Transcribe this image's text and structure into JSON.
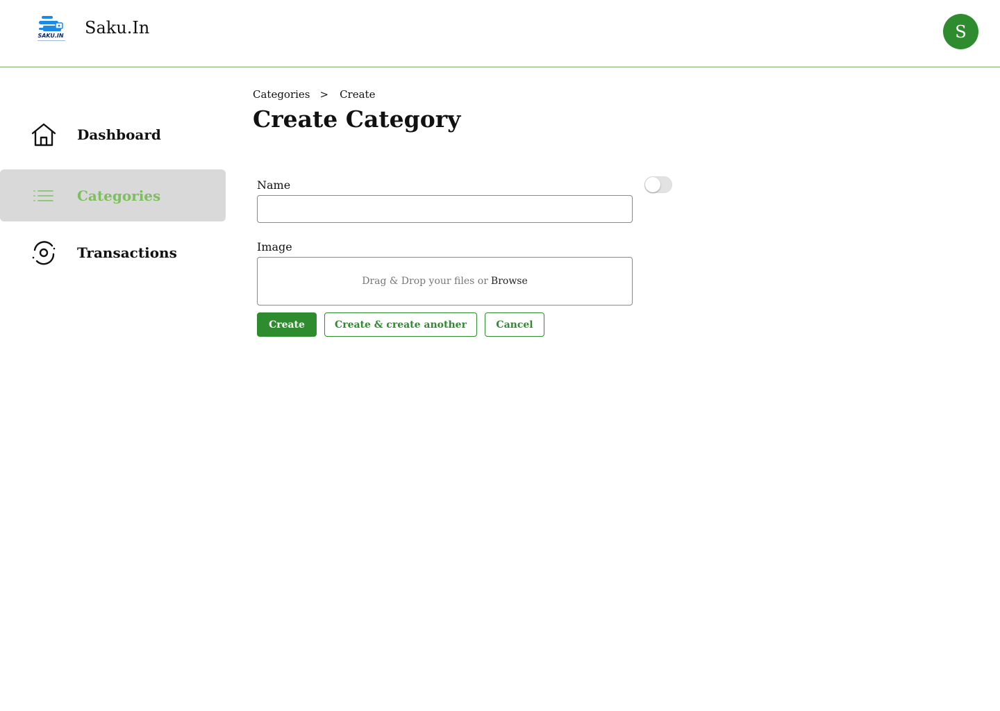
{
  "header": {
    "app_title": "Saku.In",
    "logo_text": "SAKU.IN",
    "avatar_initial": "S"
  },
  "sidebar": {
    "items": [
      {
        "label": "Dashboard",
        "icon": "home-icon",
        "active": false
      },
      {
        "label": "Categories",
        "icon": "list-icon",
        "active": true
      },
      {
        "label": "Transactions",
        "icon": "transactions-icon",
        "active": false
      }
    ]
  },
  "breadcrumb": {
    "items": [
      "Categories",
      "Create"
    ],
    "separator": ">"
  },
  "page": {
    "title": "Create Category"
  },
  "form": {
    "name_label": "Name",
    "name_value": "",
    "name_placeholder": "",
    "image_label": "Image",
    "dropzone_text": "Drag & Drop your files or",
    "browse_text": "Browse",
    "toggle_on": false
  },
  "actions": {
    "create_label": "Create",
    "create_another_label": "Create & create another",
    "cancel_label": "Cancel"
  },
  "colors": {
    "primary": "#2e8b2e",
    "active_text": "#7cbf5c",
    "active_bg": "#d9d9d9",
    "header_border": "#7fae6a",
    "logo_blue": "#1e88e5"
  }
}
